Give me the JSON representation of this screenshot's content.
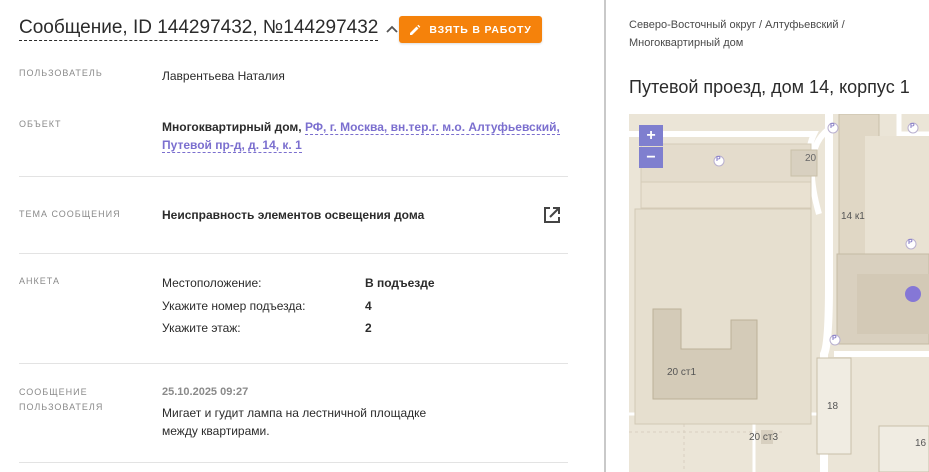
{
  "header": {
    "message_title": "Сообщение, ID 144297432, №144297432",
    "take_button_label": "ВЗЯТЬ В РАБОТУ"
  },
  "fields": {
    "user_label": "ПОЛЬЗОВАТЕЛЬ",
    "user_value": "Лаврентьева Наталия",
    "object_label": "ОБЪЕКТ",
    "object_type": "Многоквартирный дом,",
    "object_address_line1": "РФ, г. Москва, вн.тер.г. м.о. Алтуфьевский,",
    "object_address_line2": "Путевой пр-д, д. 14, к. 1",
    "topic_label": "ТЕМА СООБЩЕНИЯ",
    "topic_value": "Неисправность элементов освещения дома",
    "survey_label": "АНКЕТА",
    "survey": [
      {
        "question": "Местоположение:",
        "answer": "В подъезде"
      },
      {
        "question": "Укажите номер подъезда:",
        "answer": "4"
      },
      {
        "question": "Укажите этаж:",
        "answer": "2"
      }
    ],
    "user_message_label_1": "СООБЩЕНИЕ",
    "user_message_label_2": "ПОЛЬЗОВАТЕЛЯ",
    "user_message_date": "25.10.2025 09:27",
    "user_message_text": "Мигает и гудит лампа на лестничной площадке между квартирами."
  },
  "side": {
    "breadcrumb_1": "Северо-Восточный округ / Алтуфьевский /",
    "breadcrumb_2": "Многоквартирный дом",
    "address_title": "Путевой проезд, дом 14, корпус 1",
    "zoom_in": "+",
    "zoom_out": "−",
    "map_labels": {
      "b20": "20",
      "b14k1": "14 к1",
      "b20st1": "20 ст1",
      "b18": "18",
      "b20st3": "20 ст3",
      "b16": "16",
      "parking": "P"
    }
  },
  "colors": {
    "accent_orange": "#f5820b",
    "link_purple": "#7b6fcf",
    "map_bg": "#ebe5d7",
    "marker": "#8577d6"
  },
  "icons": [
    "pencil-icon",
    "chevron-up-icon",
    "external-link-icon",
    "parking-icon",
    "location-marker-icon"
  ]
}
